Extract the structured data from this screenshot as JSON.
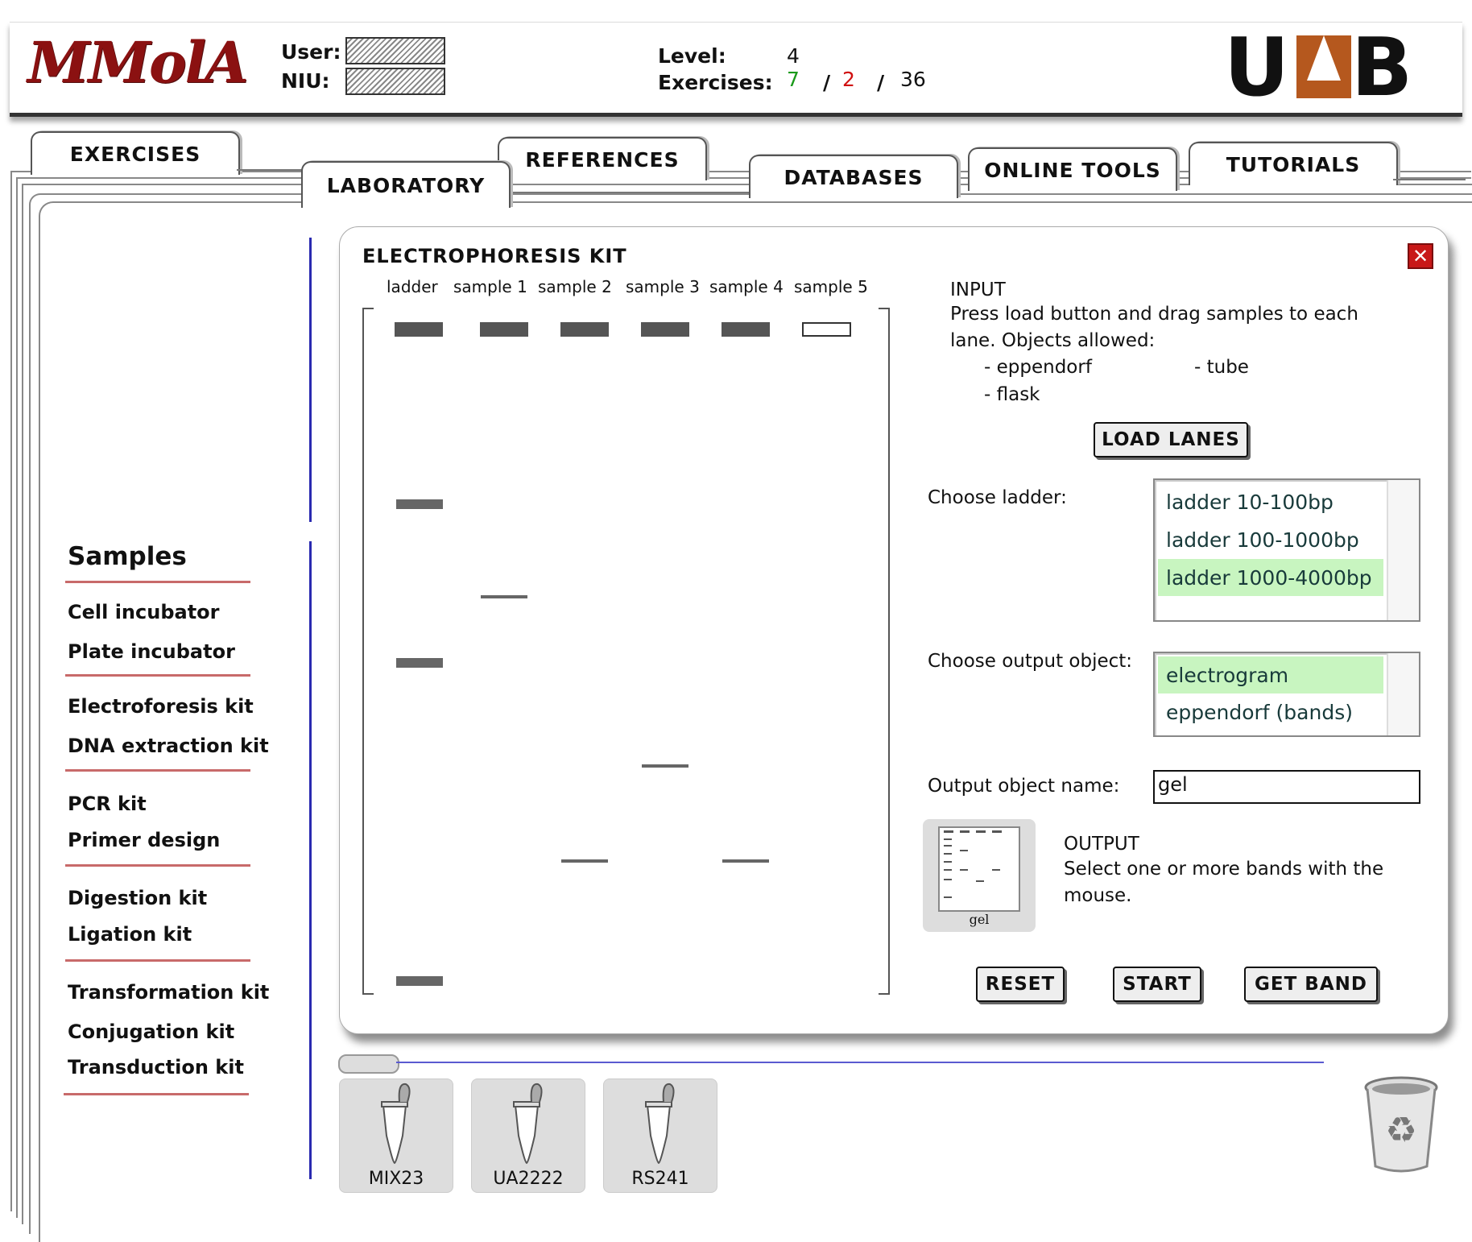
{
  "header": {
    "logo": "MMolA",
    "user_label": "User:",
    "niu_label": "NIU:",
    "level_label": "Level:",
    "level_value": "4",
    "exercises_label": "Exercises:",
    "ex_done": "7",
    "ex_sep1": "/",
    "ex_failed": "2",
    "ex_sep2": "/",
    "ex_total": "36",
    "institution_logo": "UAB",
    "colors": {
      "brand": "#8b1111",
      "done": "#1a9a1a",
      "failed": "#d01010",
      "uab_accent": "#b5581e"
    }
  },
  "tabs": [
    {
      "label": "EXERCISES"
    },
    {
      "label": "LABORATORY"
    },
    {
      "label": "REFERENCES"
    },
    {
      "label": "DATABASES"
    },
    {
      "label": "ONLINE TOOLS"
    },
    {
      "label": "TUTORIALS"
    }
  ],
  "sidebar": {
    "title": "Samples",
    "groups": [
      [
        "Cell incubator",
        "Plate incubator"
      ],
      [
        "Electroforesis kit",
        "DNA extraction kit"
      ],
      [
        "PCR kit",
        "Primer design"
      ],
      [
        "Digestion kit",
        "Ligation kit"
      ],
      [
        "Transformation kit",
        "Conjugation kit",
        "Transduction kit"
      ]
    ]
  },
  "panel": {
    "title": "ELECTROPHORESIS KIT",
    "lanes": [
      "ladder",
      "sample 1",
      "sample 2",
      "sample 3",
      "sample 4",
      "sample 5"
    ],
    "input_heading": "INPUT",
    "input_text": "Press load button and drag samples to each lane. Objects allowed:",
    "allowed": [
      "- eppendorf",
      "- tube",
      "- flask"
    ],
    "load_button": "LOAD LANES",
    "choose_ladder_label": "Choose ladder:",
    "ladders": [
      "ladder 10-100bp",
      "ladder 100-1000bp",
      "ladder 1000-4000bp"
    ],
    "selected_ladder": "ladder 1000-4000bp",
    "choose_output_label": "Choose output object:",
    "outputs": [
      "electrogram",
      "eppendorf (bands)"
    ],
    "selected_output": "electrogram",
    "output_name_label": "Output object name:",
    "output_name_value": "gel",
    "output_thumb_label": "gel",
    "output_heading": "OUTPUT",
    "output_text": "Select one or more bands with the mouse.",
    "buttons": {
      "reset": "RESET",
      "start": "START",
      "get_band": "GET BAND"
    },
    "close_icon": "close-icon"
  },
  "tray": {
    "items": [
      {
        "label": "MIX23",
        "icon": "eppendorf-tube-icon"
      },
      {
        "label": "UA2222",
        "icon": "eppendorf-tube-icon"
      },
      {
        "label": "RS241",
        "icon": "eppendorf-tube-icon"
      }
    ],
    "trash_icon": "recycle-bin-icon"
  }
}
